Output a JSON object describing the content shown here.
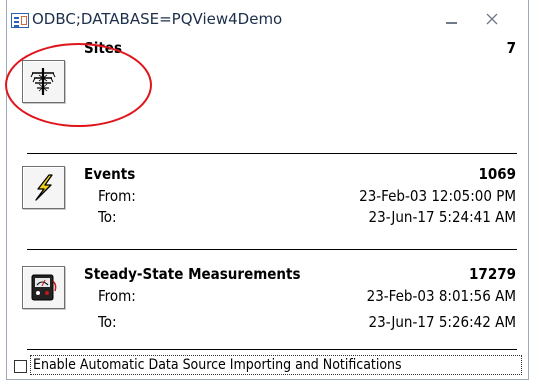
{
  "window": {
    "title": "ODBC;DATABASE=PQView4Demo",
    "icon": "form-icon",
    "minimize_icon": "minimize-icon",
    "close_icon": "close-icon"
  },
  "sites": {
    "title": "Sites",
    "count": "7",
    "icon": "transmission-tower-icon"
  },
  "events": {
    "title": "Events",
    "count": "1069",
    "from_label": "From:",
    "from_value": "23-Feb-03 12:05:00 PM",
    "to_label": "To:",
    "to_value": "23-Jun-17 5:24:41 AM",
    "icon": "lightning-bolt-icon"
  },
  "steady_state": {
    "title": "Steady-State Measurements",
    "count": "17279",
    "from_label": "From:",
    "from_value": "23-Feb-03 8:01:56 AM",
    "to_label": "To:",
    "to_value": "23-Jun-17 5:26:42 AM",
    "icon": "multimeter-icon"
  },
  "footer": {
    "checkbox_label": "Enable Automatic Data Source Importing and Notifications",
    "checked": false
  },
  "colors": {
    "annotation": "#e0151b",
    "title_icon": "#2b62b8",
    "bolt": "#f2d21a"
  }
}
